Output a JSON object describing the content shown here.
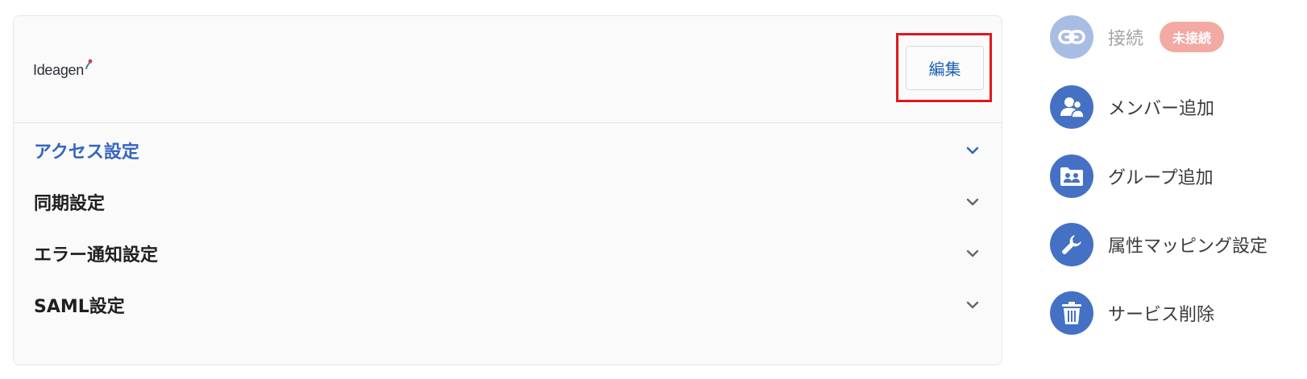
{
  "card": {
    "logo_text": "Ideagen",
    "edit_label": "編集",
    "sections": [
      {
        "label": "アクセス設定",
        "active": true
      },
      {
        "label": "同期設定",
        "active": false
      },
      {
        "label": "エラー通知設定",
        "active": false
      },
      {
        "label": "SAML設定",
        "active": false
      }
    ]
  },
  "sidebar": {
    "items": [
      {
        "label": "接続",
        "icon": "link-icon",
        "disabled": true,
        "badge": "未接続"
      },
      {
        "label": "メンバー追加",
        "icon": "users-icon",
        "disabled": false
      },
      {
        "label": "グループ追加",
        "icon": "group-folder-icon",
        "disabled": false
      },
      {
        "label": "属性マッピング設定",
        "icon": "wrench-icon",
        "disabled": false
      },
      {
        "label": "サービス削除",
        "icon": "trash-icon",
        "disabled": false
      }
    ]
  },
  "colors": {
    "accent": "#4471c4",
    "accent_disabled": "#a8bde4",
    "active_section": "#3566bf",
    "edit_text": "#1e5fb4",
    "highlight_border": "#e0161e",
    "badge_bg": "#f3aaa4"
  }
}
